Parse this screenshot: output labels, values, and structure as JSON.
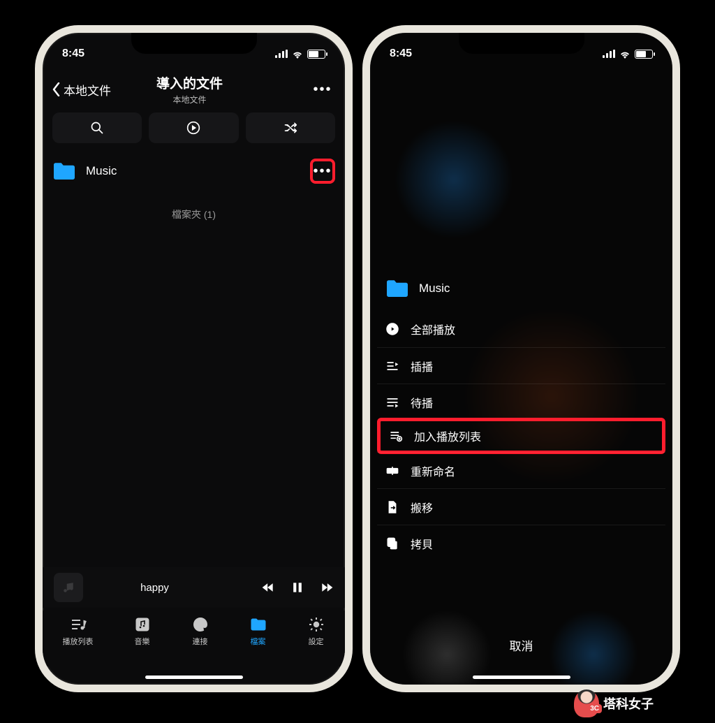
{
  "status": {
    "time": "8:45"
  },
  "left": {
    "back_label": "本地文件",
    "title": "導入的文件",
    "subtitle": "本地文件",
    "folder_label": "Music",
    "section_caption": "檔案夾 (1)",
    "nowplaying_title": "happy",
    "tabs": {
      "playlist": "播放列表",
      "music": "音樂",
      "connect": "連接",
      "files": "檔案",
      "settings": "設定"
    }
  },
  "right": {
    "folder_label": "Music",
    "menu": {
      "play_all": "全部播放",
      "insert": "插播",
      "queue": "待播",
      "add_playlist": "加入播放列表",
      "rename": "重新命名",
      "move": "搬移",
      "copy": "拷貝"
    },
    "cancel": "取消"
  },
  "watermark": "塔科女子"
}
